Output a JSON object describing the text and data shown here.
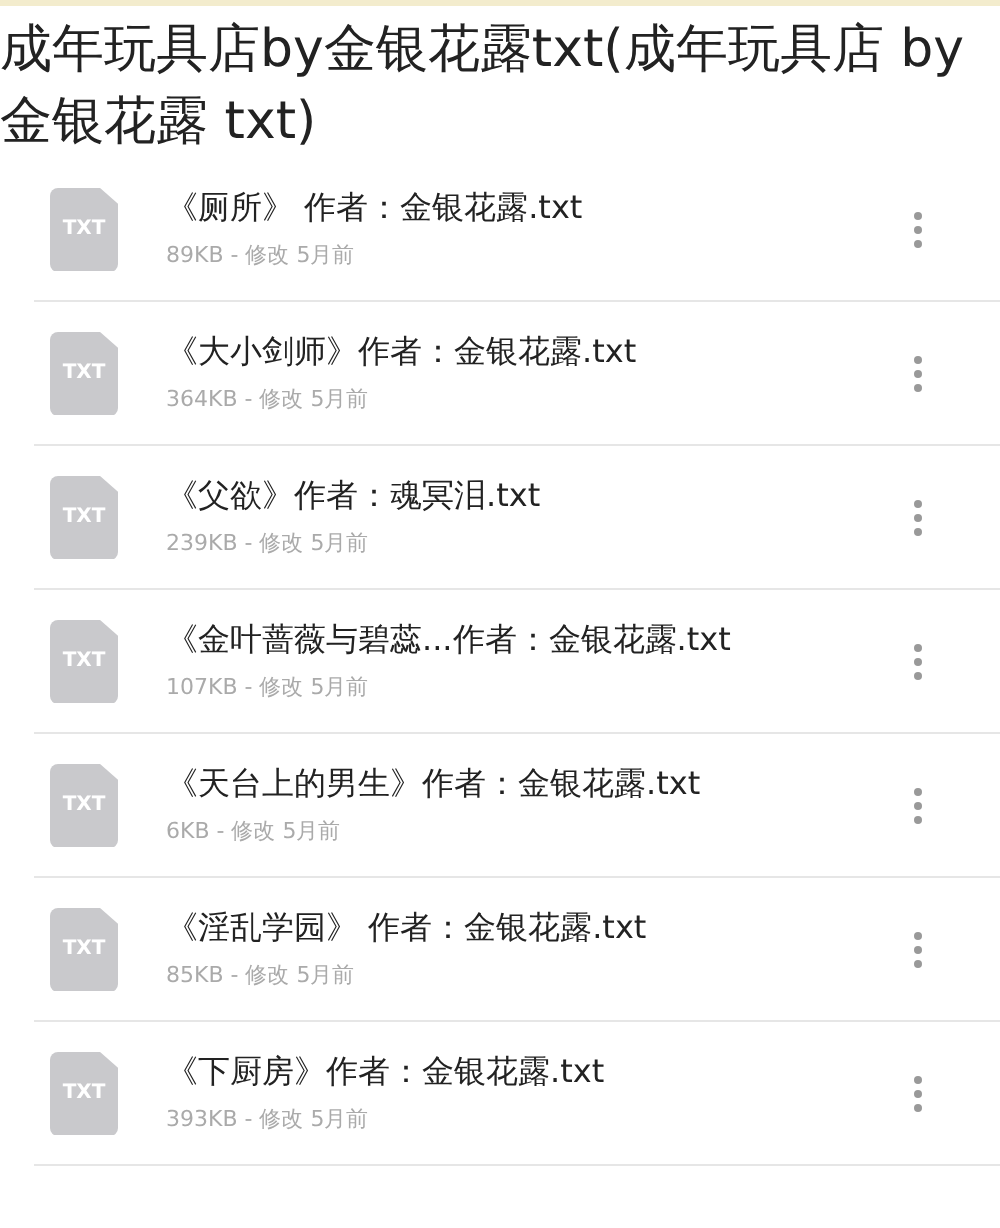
{
  "caption": "成年玩具店by金银花露txt(成年玩具店 by 金银花露 txt)",
  "files": [
    {
      "icon_label": "TXT",
      "name": "《厕所》 作者：金银花露.txt",
      "meta": "89KB - 修改 5月前"
    },
    {
      "icon_label": "TXT",
      "name": "《大小剑师》作者：金银花露.txt",
      "meta": "364KB - 修改 5月前"
    },
    {
      "icon_label": "TXT",
      "name": "《父欲》作者：魂冥泪.txt",
      "meta": "239KB - 修改 5月前"
    },
    {
      "icon_label": "TXT",
      "name": "《金叶蔷薇与碧蕊...作者：金银花露.txt",
      "meta": "107KB - 修改 5月前"
    },
    {
      "icon_label": "TXT",
      "name": "《天台上的男生》作者：金银花露.txt",
      "meta": "6KB - 修改 5月前"
    },
    {
      "icon_label": "TXT",
      "name": "《淫乱学园》 作者：金银花露.txt",
      "meta": "85KB - 修改 5月前"
    },
    {
      "icon_label": "TXT",
      "name": "《下厨房》作者：金银花露.txt",
      "meta": "393KB - 修改 5月前"
    }
  ]
}
